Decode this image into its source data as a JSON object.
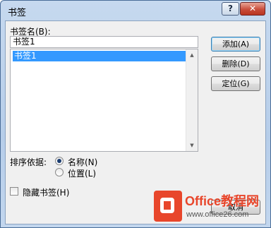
{
  "window": {
    "title": "书签"
  },
  "titlebar": {
    "help_label": "?",
    "close_label": "✕"
  },
  "bookmark_name": {
    "label": "书签名(B):",
    "value": "书签1",
    "items": [
      "书签1"
    ]
  },
  "buttons": {
    "add": "添加(A)",
    "delete": "删除(D)",
    "goto": "定位(G)",
    "cancel": "取消"
  },
  "sort": {
    "label": "排序依据:",
    "options": [
      {
        "label": "名称(N)",
        "selected": true
      },
      {
        "label": "位置(L)",
        "selected": false
      }
    ]
  },
  "hidden_bookmarks": {
    "label": "隐藏书签(H)",
    "checked": false
  },
  "watermark": {
    "title": "Office教程网",
    "url": "www.office26.com"
  },
  "colors": {
    "selection": "#3399ff",
    "brand": "#e8462b",
    "close": "#c94d3b"
  }
}
